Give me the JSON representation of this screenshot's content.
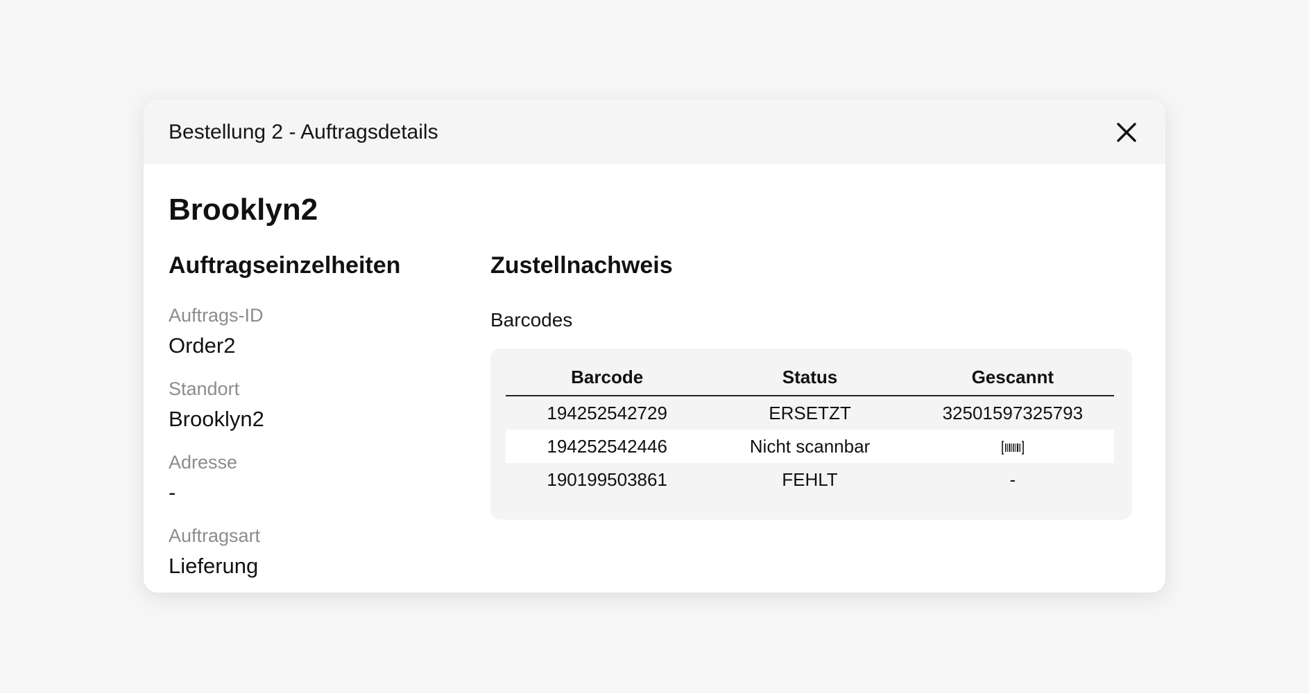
{
  "modal": {
    "title": "Bestellung 2 - Auftragsdetails",
    "close_icon": "close-icon",
    "heading": "Brooklyn2"
  },
  "details": {
    "heading": "Auftragseinzelheiten",
    "fields": [
      {
        "label": "Auftrags-ID",
        "value": "Order2"
      },
      {
        "label": "Standort",
        "value": "Brooklyn2"
      },
      {
        "label": "Adresse",
        "value": "-"
      },
      {
        "label": "Auftragsart",
        "value": "Lieferung"
      }
    ]
  },
  "proof": {
    "heading": "Zustellnachweis",
    "barcodes_label": "Barcodes",
    "table": {
      "columns": [
        "Barcode",
        "Status",
        "Gescannt"
      ],
      "rows": [
        {
          "barcode": "194252542729",
          "status": "ERSETZT",
          "scanned": "32501597325793"
        },
        {
          "barcode": "194252542446",
          "status": "Nicht scannbar",
          "scanned": "",
          "scanned_icon": "barcode-scan-icon"
        },
        {
          "barcode": "190199503861",
          "status": "FEHLT",
          "scanned": "-"
        }
      ]
    }
  }
}
